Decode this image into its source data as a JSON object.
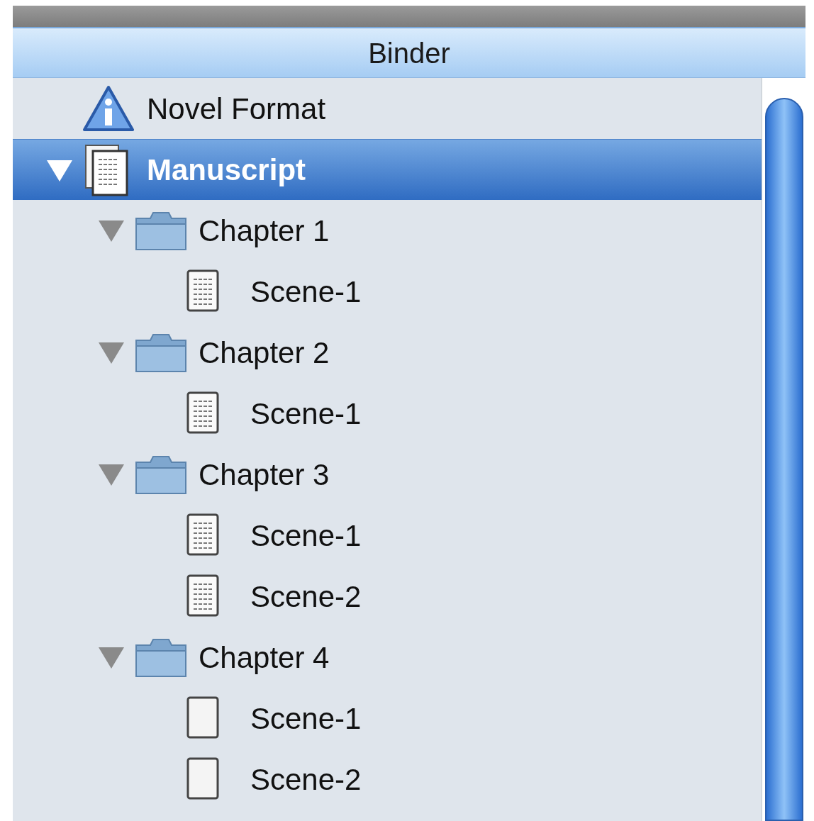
{
  "panel": {
    "title": "Binder"
  },
  "tree": [
    {
      "label": "Novel Format",
      "kind": "info",
      "selected": false
    },
    {
      "label": "Manuscript",
      "kind": "draft",
      "selected": true,
      "expanded": true,
      "children": [
        {
          "label": "Chapter 1",
          "kind": "folder",
          "selected": false,
          "expanded": true,
          "children": [
            {
              "label": "Scene-1",
              "kind": "text",
              "selected": false
            }
          ]
        },
        {
          "label": "Chapter 2",
          "kind": "folder",
          "selected": false,
          "expanded": true,
          "children": [
            {
              "label": "Scene-1",
              "kind": "text",
              "selected": false
            }
          ]
        },
        {
          "label": "Chapter 3",
          "kind": "folder",
          "selected": false,
          "expanded": true,
          "children": [
            {
              "label": "Scene-1",
              "kind": "text",
              "selected": false
            },
            {
              "label": "Scene-2",
              "kind": "text",
              "selected": false
            }
          ]
        },
        {
          "label": "Chapter 4",
          "kind": "folder",
          "selected": false,
          "expanded": true,
          "children": [
            {
              "label": "Scene-1",
              "kind": "empty",
              "selected": false
            },
            {
              "label": "Scene-2",
              "kind": "empty",
              "selected": false
            }
          ]
        }
      ]
    }
  ]
}
